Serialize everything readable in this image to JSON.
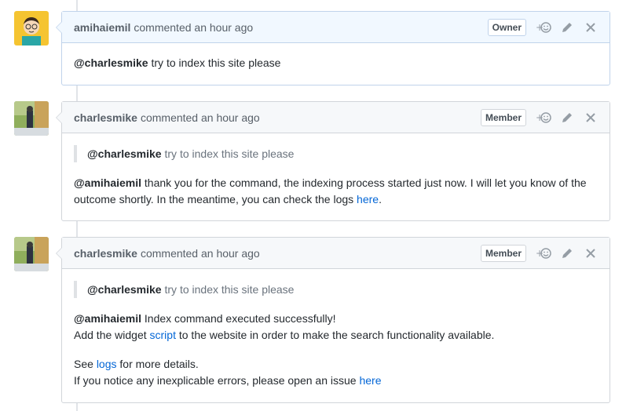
{
  "comments": [
    {
      "author": "amihaiemil",
      "meta": "commented an hour ago",
      "badge": "Owner",
      "body": {
        "mention": "@charlesmike",
        "text": " try to index this site please"
      }
    },
    {
      "author": "charlesmike",
      "meta": "commented an hour ago",
      "badge": "Member",
      "quote": {
        "mention": "@charlesmike",
        "text": " try to index this site please"
      },
      "body": {
        "mention": "@amihaiemil",
        "text": " thank you for the command, the indexing process started just now. I will let you know of the outcome shortly. In the meantime, you can check the logs ",
        "link": "here",
        "end": "."
      }
    },
    {
      "author": "charlesmike",
      "meta": "commented an hour ago",
      "badge": "Member",
      "quote": {
        "mention": "@charlesmike",
        "text": " try to index this site please"
      },
      "body": {
        "mention": "@amihaiemil",
        "line1": " Index command executed successfully!",
        "line2_pre": "Add the widget ",
        "line2_link": "script",
        "line2_post": " to the website in order to make the search functionality available.",
        "line3_pre": "See ",
        "line3_link": "logs",
        "line3_post": " for more details.",
        "line4_pre": "If you notice any inexplicable errors, please open an issue ",
        "line4_link": "here"
      }
    }
  ],
  "icons": {
    "reaction": "add-reaction-icon",
    "edit": "pencil-icon",
    "close": "close-icon"
  }
}
